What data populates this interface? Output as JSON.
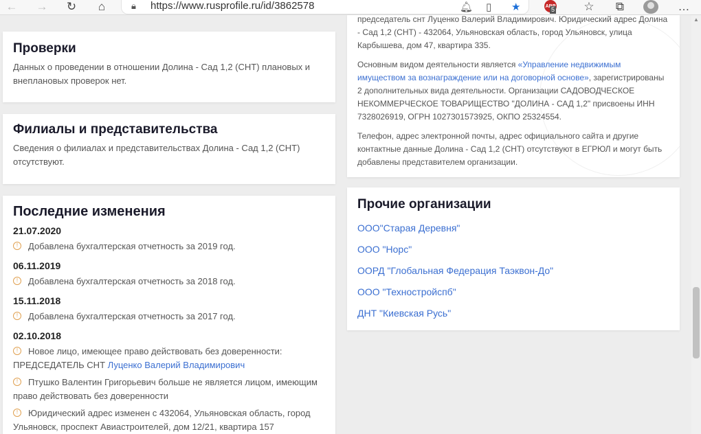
{
  "browser": {
    "url": "https://www.rusprofile.ru/id/3862578",
    "ext_badge": "ABP",
    "ext_count": "5"
  },
  "inspections": {
    "title": "Проверки",
    "text": "Данных о проведении в отношении Долина - Сад 1,2 (СНТ) плановых и внеплановых проверок нет."
  },
  "branches": {
    "title": "Филиалы и представительства",
    "text": "Сведения о филиалах и представительствах Долина - Сад 1,2 (СНТ) отсутствуют."
  },
  "changes": {
    "title": "Последние изменения",
    "groups": [
      {
        "date": "21.07.2020",
        "text": "Добавлена бухгалтерская отчетность за 2019 год."
      },
      {
        "date": "06.11.2019",
        "text": "Добавлена бухгалтерская отчетность за 2018 год."
      },
      {
        "date": "15.11.2018",
        "text": "Добавлена бухгалтерская отчетность за 2017 год."
      }
    ],
    "last_date": "02.10.2018",
    "entry1_text": "Новое лицо, имеющее право действовать без доверенности: ПРЕДСЕДАТЕЛЬ СНТ",
    "entry1_link": "Луценко Валерий Владимирович",
    "entry2_text": "Птушко Валентин Григорьевич больше не является лицом, имеющим право действовать без доверенности",
    "entry3_text": "Юридический адрес изменен с 432064, Ульяновская область, город Ульяновск, проспект Авиастроителей, дом 12/21, квартира 157"
  },
  "about": {
    "p1": "председатель снт Луценко Валерий Владимирович. Юридический адрес Долина - Сад 1,2 (СНТ) - 432064, Ульяновская область, город Ульяновск, улица Карбышева, дом 47, квартира 335.",
    "p2_pre": "Основным видом деятельности является ",
    "p2_link": "«Управление недвижимым имуществом за вознаграждение или на договорной основе»",
    "p2_post": ", зарегистрированы 2 дополнительных вида деятельности. Организации САДОВОДЧЕСКОЕ НЕКОММЕРЧЕСКОЕ ТОВАРИЩЕСТВО \"ДОЛИНА - САД 1,2\" присвоены ИНН 7328026919, ОГРН 1027301573925, ОКПО 25324554.",
    "p3": "Телефон, адрес электронной почты, адрес официального сайта и другие контактные данные Долина - Сад 1,2 (СНТ) отсутствуют в ЕГРЮЛ и могут быть добавлены представителем организации."
  },
  "others": {
    "title": "Прочие организации",
    "items": [
      "ООО\"Старая Деревня\"",
      "ООО \"Норс\"",
      "ООРД \"Глобальная Федерация Таэквон-До\"",
      "ООО \"Техностройспб\"",
      "ДНТ \"Киевская Русь\""
    ]
  }
}
